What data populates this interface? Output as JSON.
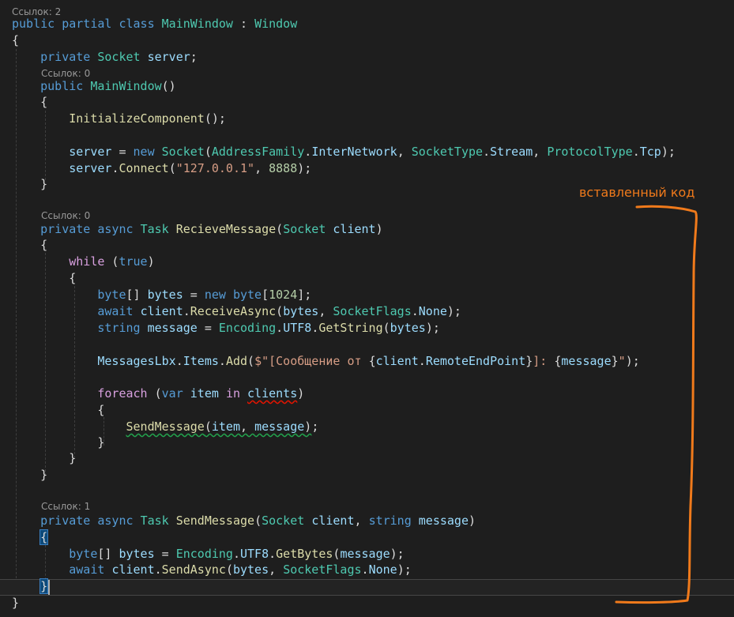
{
  "annotation": {
    "label": "вставленный код",
    "color": "#f07a1b"
  },
  "code_lens": {
    "class_refs": "Ссылок: 2",
    "ctor_refs": "Ссылок: 0",
    "recieve_refs": "Ссылок: 0",
    "send_refs": "Ссылок: 1"
  },
  "code": {
    "class_decl": [
      {
        "t": "public",
        "c": "kw"
      },
      {
        "t": " ",
        "c": "txt"
      },
      {
        "t": "partial",
        "c": "kw"
      },
      {
        "t": " ",
        "c": "txt"
      },
      {
        "t": "class",
        "c": "kw"
      },
      {
        "t": " ",
        "c": "txt"
      },
      {
        "t": "MainWindow",
        "c": "type"
      },
      {
        "t": " : ",
        "c": "txt"
      },
      {
        "t": "Window",
        "c": "type"
      }
    ],
    "open_class": [
      {
        "t": "{",
        "c": "txt"
      }
    ],
    "field": [
      {
        "t": "    ",
        "c": "txt"
      },
      {
        "t": "private",
        "c": "kw"
      },
      {
        "t": " ",
        "c": "txt"
      },
      {
        "t": "Socket",
        "c": "type"
      },
      {
        "t": " ",
        "c": "txt"
      },
      {
        "t": "server",
        "c": "var"
      },
      {
        "t": ";",
        "c": "txt"
      }
    ],
    "ctor_decl": [
      {
        "t": "    ",
        "c": "txt"
      },
      {
        "t": "public",
        "c": "kw"
      },
      {
        "t": " ",
        "c": "txt"
      },
      {
        "t": "MainWindow",
        "c": "type"
      },
      {
        "t": "()",
        "c": "txt"
      }
    ],
    "ctor_open": [
      {
        "t": "    {",
        "c": "txt"
      }
    ],
    "init": [
      {
        "t": "        ",
        "c": "txt"
      },
      {
        "t": "InitializeComponent",
        "c": "meth"
      },
      {
        "t": "();",
        "c": "txt"
      }
    ],
    "server_new": [
      {
        "t": "        ",
        "c": "txt"
      },
      {
        "t": "server",
        "c": "var"
      },
      {
        "t": " = ",
        "c": "txt"
      },
      {
        "t": "new",
        "c": "kw"
      },
      {
        "t": " ",
        "c": "txt"
      },
      {
        "t": "Socket",
        "c": "type"
      },
      {
        "t": "(",
        "c": "txt"
      },
      {
        "t": "AddressFamily",
        "c": "type"
      },
      {
        "t": ".",
        "c": "txt"
      },
      {
        "t": "InterNetwork",
        "c": "var"
      },
      {
        "t": ", ",
        "c": "txt"
      },
      {
        "t": "SocketType",
        "c": "type"
      },
      {
        "t": ".",
        "c": "txt"
      },
      {
        "t": "Stream",
        "c": "var"
      },
      {
        "t": ", ",
        "c": "txt"
      },
      {
        "t": "ProtocolType",
        "c": "type"
      },
      {
        "t": ".",
        "c": "txt"
      },
      {
        "t": "Tcp",
        "c": "var"
      },
      {
        "t": ");",
        "c": "txt"
      }
    ],
    "server_connect": [
      {
        "t": "        ",
        "c": "txt"
      },
      {
        "t": "server",
        "c": "var"
      },
      {
        "t": ".",
        "c": "txt"
      },
      {
        "t": "Connect",
        "c": "meth"
      },
      {
        "t": "(",
        "c": "txt"
      },
      {
        "t": "\"127.0.0.1\"",
        "c": "str"
      },
      {
        "t": ", ",
        "c": "txt"
      },
      {
        "t": "8888",
        "c": "num"
      },
      {
        "t": ");",
        "c": "txt"
      }
    ],
    "ctor_close": [
      {
        "t": "    }",
        "c": "txt"
      }
    ],
    "recv_decl": [
      {
        "t": "    ",
        "c": "txt"
      },
      {
        "t": "private",
        "c": "kw"
      },
      {
        "t": " ",
        "c": "txt"
      },
      {
        "t": "async",
        "c": "kw"
      },
      {
        "t": " ",
        "c": "txt"
      },
      {
        "t": "Task",
        "c": "type"
      },
      {
        "t": " ",
        "c": "txt"
      },
      {
        "t": "RecieveMessage",
        "c": "meth"
      },
      {
        "t": "(",
        "c": "txt"
      },
      {
        "t": "Socket",
        "c": "type"
      },
      {
        "t": " ",
        "c": "txt"
      },
      {
        "t": "client",
        "c": "var"
      },
      {
        "t": ")",
        "c": "txt"
      }
    ],
    "recv_open": [
      {
        "t": "    {",
        "c": "txt"
      }
    ],
    "while": [
      {
        "t": "        ",
        "c": "txt"
      },
      {
        "t": "while",
        "c": "ctl"
      },
      {
        "t": " (",
        "c": "txt"
      },
      {
        "t": "true",
        "c": "kw"
      },
      {
        "t": ")",
        "c": "txt"
      }
    ],
    "while_open": [
      {
        "t": "        {",
        "c": "txt"
      }
    ],
    "bytes_decl": [
      {
        "t": "            ",
        "c": "txt"
      },
      {
        "t": "byte",
        "c": "kw"
      },
      {
        "t": "[] ",
        "c": "txt"
      },
      {
        "t": "bytes",
        "c": "var"
      },
      {
        "t": " = ",
        "c": "txt"
      },
      {
        "t": "new",
        "c": "kw"
      },
      {
        "t": " ",
        "c": "txt"
      },
      {
        "t": "byte",
        "c": "kw"
      },
      {
        "t": "[",
        "c": "txt"
      },
      {
        "t": "1024",
        "c": "num"
      },
      {
        "t": "];",
        "c": "txt"
      }
    ],
    "await_recv": [
      {
        "t": "            ",
        "c": "txt"
      },
      {
        "t": "await",
        "c": "kw"
      },
      {
        "t": " ",
        "c": "txt"
      },
      {
        "t": "client",
        "c": "var"
      },
      {
        "t": ".",
        "c": "txt"
      },
      {
        "t": "ReceiveAsync",
        "c": "meth"
      },
      {
        "t": "(",
        "c": "txt"
      },
      {
        "t": "bytes",
        "c": "var"
      },
      {
        "t": ", ",
        "c": "txt"
      },
      {
        "t": "SocketFlags",
        "c": "type"
      },
      {
        "t": ".",
        "c": "txt"
      },
      {
        "t": "None",
        "c": "var"
      },
      {
        "t": ");",
        "c": "txt"
      }
    ],
    "string_msg": [
      {
        "t": "            ",
        "c": "txt"
      },
      {
        "t": "string",
        "c": "kw"
      },
      {
        "t": " ",
        "c": "txt"
      },
      {
        "t": "message",
        "c": "var"
      },
      {
        "t": " = ",
        "c": "txt"
      },
      {
        "t": "Encoding",
        "c": "type"
      },
      {
        "t": ".",
        "c": "txt"
      },
      {
        "t": "UTF8",
        "c": "var"
      },
      {
        "t": ".",
        "c": "txt"
      },
      {
        "t": "GetString",
        "c": "meth"
      },
      {
        "t": "(",
        "c": "txt"
      },
      {
        "t": "bytes",
        "c": "var"
      },
      {
        "t": ");",
        "c": "txt"
      }
    ],
    "messages_add": [
      {
        "t": "            ",
        "c": "txt"
      },
      {
        "t": "MessagesLbx",
        "c": "var"
      },
      {
        "t": ".",
        "c": "txt"
      },
      {
        "t": "Items",
        "c": "var"
      },
      {
        "t": ".",
        "c": "txt"
      },
      {
        "t": "Add",
        "c": "meth"
      },
      {
        "t": "(",
        "c": "txt"
      },
      {
        "t": "$\"[Сообщение от ",
        "c": "str"
      },
      {
        "t": "{",
        "c": "txt"
      },
      {
        "t": "client",
        "c": "var"
      },
      {
        "t": ".",
        "c": "txt"
      },
      {
        "t": "RemoteEndPoint",
        "c": "var"
      },
      {
        "t": "}",
        "c": "txt"
      },
      {
        "t": "]: ",
        "c": "str"
      },
      {
        "t": "{",
        "c": "txt"
      },
      {
        "t": "message",
        "c": "var"
      },
      {
        "t": "}",
        "c": "txt"
      },
      {
        "t": "\"",
        "c": "str"
      },
      {
        "t": ");",
        "c": "txt"
      }
    ],
    "foreach": [
      {
        "t": "            ",
        "c": "txt"
      },
      {
        "t": "foreach",
        "c": "ctl"
      },
      {
        "t": " (",
        "c": "txt"
      },
      {
        "t": "var",
        "c": "kw"
      },
      {
        "t": " ",
        "c": "txt"
      },
      {
        "t": "item",
        "c": "var"
      },
      {
        "t": " ",
        "c": "txt"
      },
      {
        "t": "in",
        "c": "ctl"
      },
      {
        "t": " ",
        "c": "txt"
      },
      {
        "t": "clients",
        "c": "var",
        "u": "red"
      },
      {
        "t": ")",
        "c": "txt"
      }
    ],
    "foreach_open": [
      {
        "t": "            {",
        "c": "txt"
      }
    ],
    "send_call": [
      {
        "t": "                ",
        "c": "txt"
      },
      {
        "t": "SendMessage(item, message)",
        "c": "meth",
        "u": "green",
        "parts": true
      },
      {
        "t": ";",
        "c": "txt"
      }
    ],
    "foreach_close": [
      {
        "t": "            }",
        "c": "txt"
      }
    ],
    "while_close": [
      {
        "t": "        }",
        "c": "txt"
      }
    ],
    "recv_close": [
      {
        "t": "    }",
        "c": "txt"
      }
    ],
    "send_decl": [
      {
        "t": "    ",
        "c": "txt"
      },
      {
        "t": "private",
        "c": "kw"
      },
      {
        "t": " ",
        "c": "txt"
      },
      {
        "t": "async",
        "c": "kw"
      },
      {
        "t": " ",
        "c": "txt"
      },
      {
        "t": "Task",
        "c": "type"
      },
      {
        "t": " ",
        "c": "txt"
      },
      {
        "t": "SendMessage",
        "c": "meth",
        "u": "plain"
      },
      {
        "t": "(",
        "c": "txt"
      },
      {
        "t": "Socket",
        "c": "type"
      },
      {
        "t": " ",
        "c": "txt"
      },
      {
        "t": "client",
        "c": "var"
      },
      {
        "t": ", ",
        "c": "txt"
      },
      {
        "t": "string",
        "c": "kw"
      },
      {
        "t": " ",
        "c": "txt"
      },
      {
        "t": "message",
        "c": "var"
      },
      {
        "t": ")",
        "c": "txt"
      }
    ],
    "send_open": [
      {
        "t": "    ",
        "c": "txt"
      },
      {
        "t": "{",
        "c": "txt",
        "m": true
      }
    ],
    "getbytes": [
      {
        "t": "        ",
        "c": "txt"
      },
      {
        "t": "byte",
        "c": "kw"
      },
      {
        "t": "[] ",
        "c": "txt"
      },
      {
        "t": "bytes",
        "c": "var"
      },
      {
        "t": " = ",
        "c": "txt"
      },
      {
        "t": "Encoding",
        "c": "type"
      },
      {
        "t": ".",
        "c": "txt"
      },
      {
        "t": "UTF8",
        "c": "var"
      },
      {
        "t": ".",
        "c": "txt"
      },
      {
        "t": "GetBytes",
        "c": "meth"
      },
      {
        "t": "(",
        "c": "txt"
      },
      {
        "t": "message",
        "c": "var"
      },
      {
        "t": ");",
        "c": "txt"
      }
    ],
    "await_send": [
      {
        "t": "        ",
        "c": "txt"
      },
      {
        "t": "await",
        "c": "kw"
      },
      {
        "t": " ",
        "c": "txt"
      },
      {
        "t": "client",
        "c": "var"
      },
      {
        "t": ".",
        "c": "txt"
      },
      {
        "t": "SendAsync",
        "c": "meth"
      },
      {
        "t": "(",
        "c": "txt"
      },
      {
        "t": "bytes",
        "c": "var"
      },
      {
        "t": ", ",
        "c": "txt"
      },
      {
        "t": "SocketFlags",
        "c": "type"
      },
      {
        "t": ".",
        "c": "txt"
      },
      {
        "t": "None",
        "c": "var"
      },
      {
        "t": ");",
        "c": "txt"
      }
    ],
    "send_close": [
      {
        "t": "    ",
        "c": "txt"
      },
      {
        "t": "}",
        "c": "txt",
        "m": true
      }
    ],
    "close_class": [
      {
        "t": "}",
        "c": "txt"
      }
    ]
  }
}
